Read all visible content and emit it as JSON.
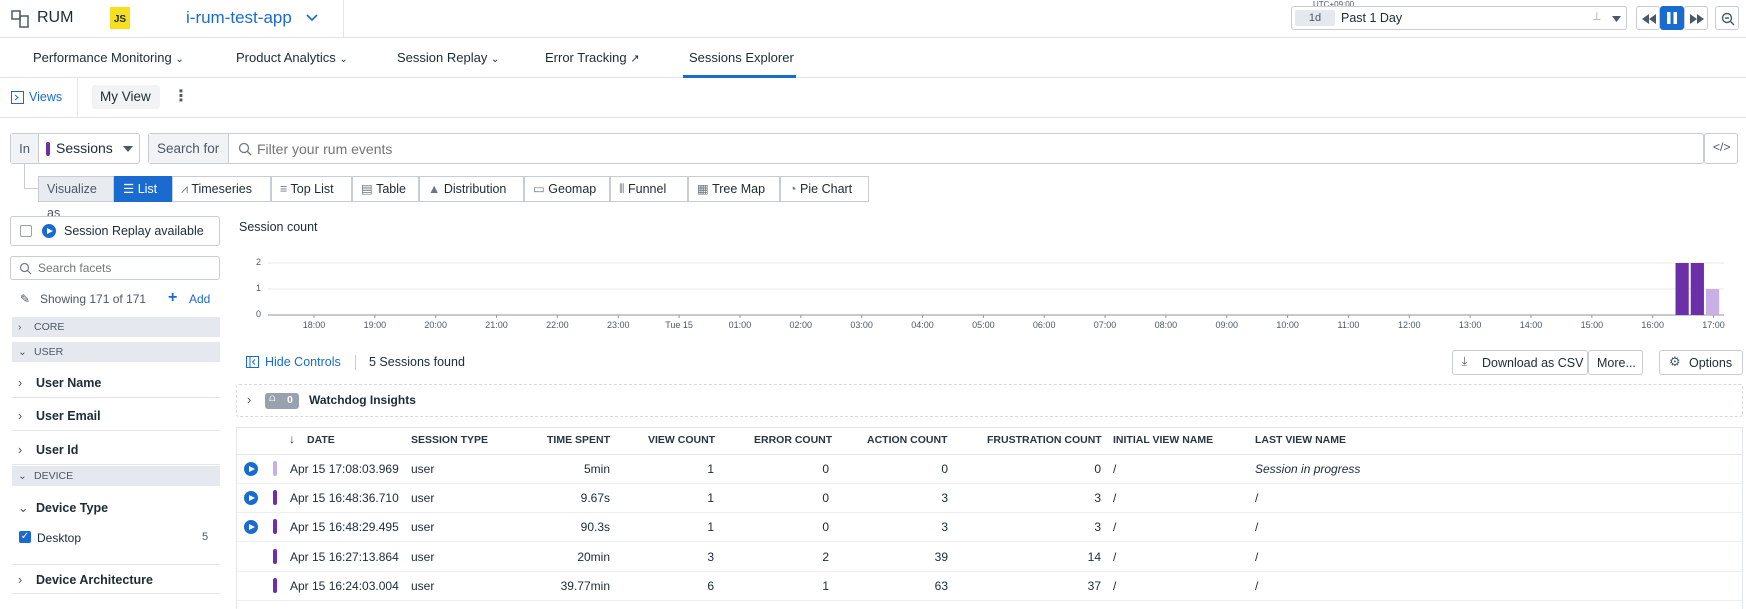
{
  "app": {
    "product": "RUM",
    "badge": "JS",
    "app_name": "i-rum-test-app"
  },
  "time": {
    "timezone": "UTC+09:00",
    "range_short": "1d",
    "range_label": "Past 1 Day"
  },
  "nav": {
    "tabs": [
      "Performance Monitoring",
      "Product Analytics",
      "Session Replay",
      "Error Tracking",
      "Sessions Explorer"
    ],
    "active": "Sessions Explorer"
  },
  "views": {
    "views_label": "Views",
    "current_view": "My View"
  },
  "query": {
    "in_label": "In",
    "source": "Sessions",
    "search_for_label": "Search for",
    "placeholder": "Filter your rum events"
  },
  "visualize": {
    "label": "Visualize as",
    "options": [
      "List",
      "Timeseries",
      "Top List",
      "Table",
      "Distribution",
      "Geomap",
      "Funnel",
      "Tree Map",
      "Pie Chart"
    ],
    "active": "List"
  },
  "facets": {
    "replay_toggle": "Session Replay available",
    "search_placeholder": "Search facets",
    "showing": "Showing 171 of 171",
    "add_label": "Add",
    "groups": [
      "CORE",
      "USER"
    ],
    "user_facets": [
      "User Name",
      "User Email",
      "User Id"
    ],
    "device_group": "DEVICE",
    "device_type": "Device Type",
    "device_type_value": {
      "label": "Desktop",
      "count": "5",
      "checked": true
    },
    "device_arch": "Device Architecture"
  },
  "chart_data": {
    "type": "bar",
    "title": "Session count",
    "x_ticks": [
      "18:00",
      "19:00",
      "20:00",
      "21:00",
      "22:00",
      "23:00",
      "Tue 15",
      "01:00",
      "02:00",
      "03:00",
      "04:00",
      "05:00",
      "06:00",
      "07:00",
      "08:00",
      "09:00",
      "10:00",
      "11:00",
      "12:00",
      "13:00",
      "14:00",
      "15:00",
      "16:00",
      "17:00"
    ],
    "y_ticks": [
      "0",
      "1",
      "2"
    ],
    "ylim": [
      0,
      2
    ],
    "bars": [
      {
        "x": "16:30",
        "value": 2,
        "status": "complete"
      },
      {
        "x": "16:45",
        "value": 2,
        "status": "complete"
      },
      {
        "x": "17:00",
        "value": 1,
        "status": "in progress"
      }
    ],
    "colors": {
      "complete": "#6b2fa8",
      "in_progress": "#c8b0e6"
    }
  },
  "controls": {
    "hide": "Hide Controls",
    "found": "5 Sessions found",
    "download": "Download as CSV",
    "more": "More...",
    "options": "Options"
  },
  "watchdog": {
    "count": "0",
    "label": "Watchdog Insights"
  },
  "table": {
    "columns": [
      "DATE",
      "SESSION TYPE",
      "TIME SPENT",
      "VIEW COUNT",
      "ERROR COUNT",
      "ACTION COUNT",
      "FRUSTRATION COUNT",
      "INITIAL VIEW NAME",
      "LAST VIEW NAME"
    ],
    "rows": [
      {
        "replay": true,
        "in_progress": true,
        "date": "Apr 15 17:08:03.969",
        "type": "user",
        "time": "5min",
        "views": "1",
        "errors": "0",
        "actions": "0",
        "frustration": "0",
        "initial": "/",
        "last": "Session in progress"
      },
      {
        "replay": true,
        "in_progress": false,
        "date": "Apr 15 16:48:36.710",
        "type": "user",
        "time": "9.67s",
        "views": "1",
        "errors": "0",
        "actions": "3",
        "frustration": "3",
        "initial": "/",
        "last": "/"
      },
      {
        "replay": true,
        "in_progress": false,
        "date": "Apr 15 16:48:29.495",
        "type": "user",
        "time": "90.3s",
        "views": "1",
        "errors": "0",
        "actions": "3",
        "frustration": "3",
        "initial": "/",
        "last": "/"
      },
      {
        "replay": false,
        "in_progress": false,
        "date": "Apr 15 16:27:13.864",
        "type": "user",
        "time": "20min",
        "views": "3",
        "errors": "2",
        "actions": "39",
        "frustration": "14",
        "initial": "/",
        "last": "/"
      },
      {
        "replay": false,
        "in_progress": false,
        "date": "Apr 15 16:24:03.004",
        "type": "user",
        "time": "39.77min",
        "views": "6",
        "errors": "1",
        "actions": "63",
        "frustration": "37",
        "initial": "/",
        "last": "/"
      }
    ]
  }
}
